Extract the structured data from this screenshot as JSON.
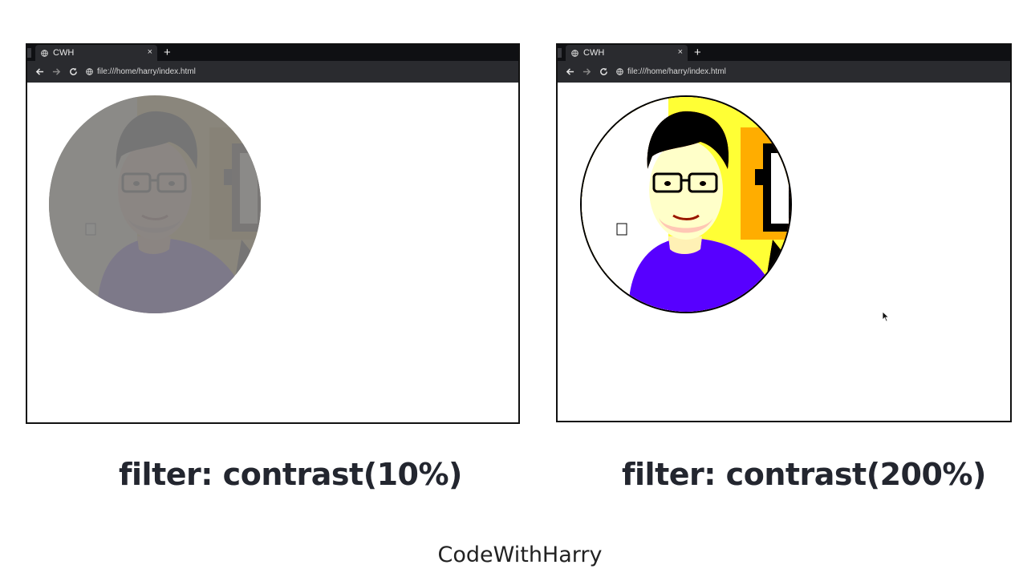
{
  "left_window": {
    "tab_title": "CWH",
    "tab_close": "×",
    "new_tab": "+",
    "url": "file:///home/harry/index.html"
  },
  "right_window": {
    "tab_title": "CWH",
    "tab_close": "×",
    "new_tab": "+",
    "url": "file:///home/harry/index.html"
  },
  "captions": {
    "left": "filter: contrast(10%)",
    "right": "filter: contrast(200%)"
  },
  "footer": "CodeWithHarry",
  "colors": {
    "chrome_dark": "#0f1013",
    "chrome_toolbar": "#2a2b2f",
    "caption_text": "#23262f"
  }
}
